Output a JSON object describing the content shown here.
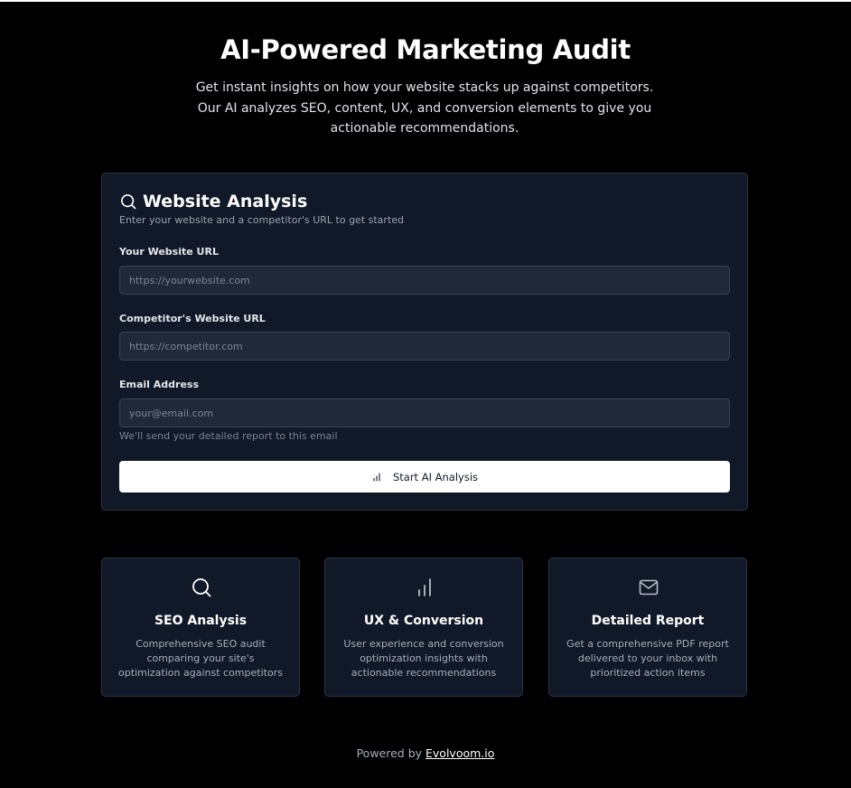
{
  "hero": {
    "title": "AI-Powered Marketing Audit",
    "subtitle": "Get instant insights on how your website stacks up against competitors. Our AI analyzes SEO, content, UX, and conversion elements to give you actionable recommendations."
  },
  "form": {
    "icon": "search-icon",
    "title": "Website Analysis",
    "description": "Enter your website and a competitor's URL to get started",
    "website": {
      "label": "Your Website URL",
      "placeholder": "https://yourwebsite.com",
      "value": ""
    },
    "competitor": {
      "label": "Competitor's Website URL",
      "placeholder": "https://competitor.com",
      "value": ""
    },
    "email": {
      "label": "Email Address",
      "placeholder": "your@email.com",
      "value": "",
      "helper": "We'll send your detailed report to this email"
    },
    "submit": {
      "icon": "bar-chart-icon",
      "label": "Start AI Analysis"
    }
  },
  "features": [
    {
      "icon": "search-icon",
      "title": "SEO Analysis",
      "description": "Comprehensive SEO audit comparing your site's optimization against competitors"
    },
    {
      "icon": "bar-chart-icon",
      "title": "UX & Conversion",
      "description": "User experience and conversion optimization insights with actionable recommendations"
    },
    {
      "icon": "mail-icon",
      "title": "Detailed Report",
      "description": "Get a comprehensive PDF report delivered to your inbox with prioritized action items"
    }
  ],
  "footer": {
    "prefix": "Powered by",
    "link_text": "Evolvoom.io"
  },
  "colors": {
    "background": "#000000",
    "card": "#111827",
    "input": "#1f2937",
    "button": "#ffffff"
  }
}
